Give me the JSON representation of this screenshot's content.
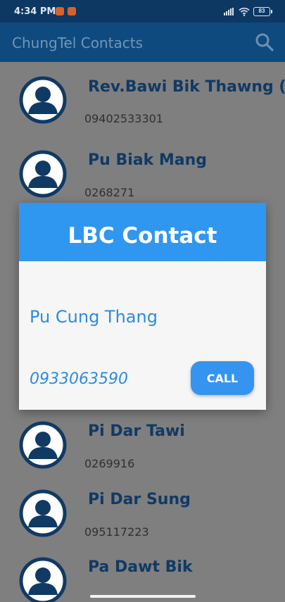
{
  "status_bar": {
    "time": "4:34 PM",
    "battery": "83"
  },
  "app_bar": {
    "title": "ChungTel Contacts",
    "search_icon": "search-icon"
  },
  "contacts": [
    {
      "name": "Rev.Bawi Bik Thawng (Pastor)",
      "phone": "09402533301"
    },
    {
      "name": "Pu Biak Mang",
      "phone": "0268271"
    },
    {
      "name": "Pi Dar Tawi",
      "phone": "0269916"
    },
    {
      "name": "Pi Dar Sung",
      "phone": "095117223"
    },
    {
      "name": "Pa Dawt Bik",
      "phone": ""
    }
  ],
  "dialog": {
    "title": "LBC Contact",
    "name": "Pu Cung Thang",
    "phone": "0933063590",
    "call_label": "CALL"
  },
  "colors": {
    "dialog_header": "#2f97f0",
    "accent_text": "#2c8be0",
    "app_bar": "#0f4a7e",
    "scrim": "#7f7f7f"
  }
}
